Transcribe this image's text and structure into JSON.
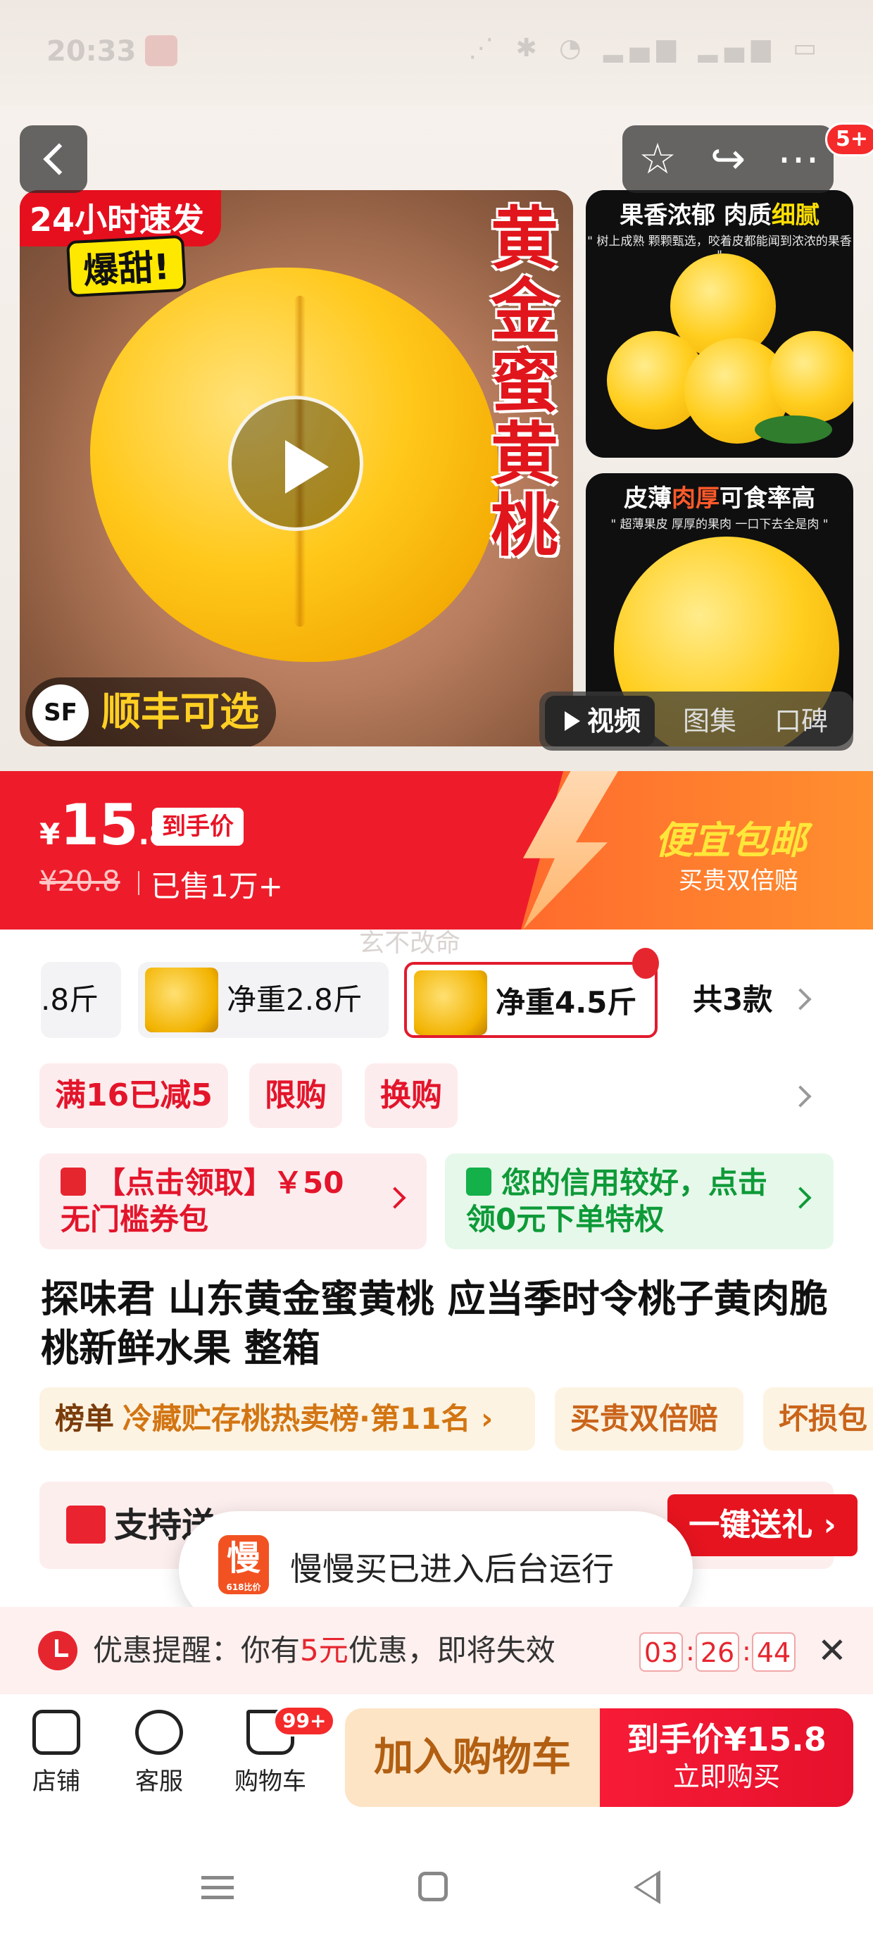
{
  "status": {
    "time": "20:33",
    "icons": "⋰ ✱ ◔ ▂▄▆ ▂▄▆ ▭"
  },
  "hero": {
    "badge_24h": "24小时速发",
    "badge_sweet": "爆甜!",
    "vertical_title": "黄金蜜黄桃",
    "sf_badge": "顺丰可选",
    "sf_logo": "SF",
    "side1_title_a": "果香浓郁 肉质",
    "side1_title_hl": "细腻",
    "side1_sub": "\" 树上成熟 颗颗甄选，咬着皮都能闻到浓浓的果香 \"",
    "side2_title_a": "皮薄",
    "side2_title_hl": "肉厚",
    "side2_title_b": "可食率高",
    "side2_sub": "\" 超薄果皮 厚厚的果肉 一口下去全是肉 \"",
    "tabs": {
      "video": "视频",
      "gallery": "图集",
      "reviews": "口碑"
    },
    "more_badge": "5+"
  },
  "price": {
    "currency": "¥",
    "integer": "15",
    "decimal": ".8",
    "final_tag": "到手价",
    "original": "¥20.8",
    "sold": "已售1万+",
    "promo_title": "便宜包邮",
    "promo_sub": "买贵双倍赔"
  },
  "watermark": "玄不改命",
  "sku": {
    "items": [
      ".8斤",
      "净重2.8斤",
      "净重4.5斤"
    ],
    "total": "共3款"
  },
  "coupon_tags": [
    "满16已减5",
    "限购",
    "换购"
  ],
  "coupon_boxes": {
    "red": "【点击领取】￥50 无门槛券包",
    "green": "您的信用较好，点击领0元下单特权"
  },
  "product_title": "探味君 山东黄金蜜黄桃 应当季时令桃子黄肉脆桃新鲜水果 整箱",
  "rank": {
    "label": "榜单",
    "text": "冷藏贮存桃热卖榜·第11名 ›"
  },
  "guarantee_tags": [
    "买贵双倍赔",
    "坏损包"
  ],
  "gift": {
    "text": "支持送",
    "button": "一键送礼 ›"
  },
  "toast": {
    "logo": "慢",
    "logo_sub": "618比价",
    "text": "慢慢买已进入后台运行"
  },
  "reminder": {
    "prefix": "优惠提醒：你有",
    "amount": "5元",
    "suffix": "优惠，即将失效",
    "countdown": [
      "03",
      "26",
      "44"
    ],
    "close": "✕"
  },
  "bottom": {
    "shop": "店铺",
    "service": "客服",
    "cart": "购物车",
    "cart_badge": "99+",
    "add_to_cart": "加入购物车",
    "buy_line1": "到手价¥15.8",
    "buy_line2": "立即购买"
  },
  "colors": {
    "brand_red": "#ee1c2a",
    "promo_orange": "#ff7b2e",
    "green": "#0e9a38"
  }
}
